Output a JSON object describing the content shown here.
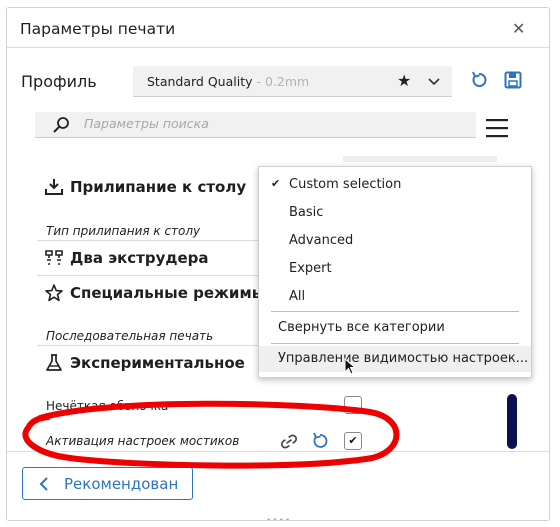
{
  "window": {
    "title": "Параметры печати"
  },
  "profile": {
    "label": "Профиль",
    "name": "Standard Quality",
    "sub": " - 0.2mm"
  },
  "search": {
    "placeholder": "Параметры поиска"
  },
  "categories": [
    {
      "label": "Прилипание к столу",
      "icon": "bed-adhesion-icon"
    },
    {
      "label": "Два экструдера",
      "icon": "dual-extrusion-icon"
    },
    {
      "label": "Специальные режимы",
      "icon": "star-icon"
    },
    {
      "label": "Экспериментальное",
      "icon": "flask-icon"
    }
  ],
  "settings": [
    {
      "label": "Тип прилипания к столу"
    },
    {
      "label": "Последовательная печать"
    },
    {
      "label": "Нечёткая оболочка",
      "checked": false
    },
    {
      "label": "Активация настроек мостиков",
      "checked": true
    }
  ],
  "menu": {
    "items": [
      {
        "label": "Custom selection",
        "checked": true
      },
      {
        "label": "Basic",
        "checked": false
      },
      {
        "label": "Advanced",
        "checked": false
      },
      {
        "label": "Expert",
        "checked": false
      },
      {
        "label": "All",
        "checked": false
      }
    ],
    "collapse_all": "Свернуть все категории",
    "manage_visibility": "Управление видимостью настроек..."
  },
  "footer": {
    "recommended": "Рекомендован"
  },
  "colors": {
    "accent": "#2e73c4",
    "scrollbar": "#0b1050",
    "annotation": "#ee0000"
  }
}
